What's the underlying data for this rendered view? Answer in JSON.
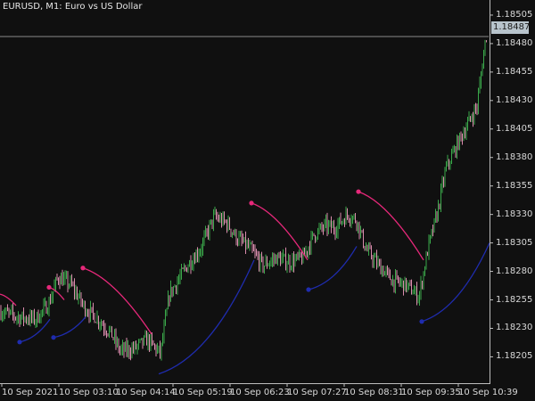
{
  "window": {
    "title": "EURUSD, M1:  Euro vs US Dollar",
    "current_price": "1.18487"
  },
  "colors": {
    "background": "#101010",
    "bull_candle": "#3aa84a",
    "bear_candle": "#d98cac",
    "upper_arc": "#e6287a",
    "lower_arc": "#1f2cae",
    "grid_line": "#8a8a8a"
  },
  "chart_data": {
    "type": "candlestick",
    "symbol": "EURUSD",
    "timeframe": "M1",
    "y_tick_labels": [
      "1.18505",
      "1.18480",
      "1.18455",
      "1.18430",
      "1.18405",
      "1.18380",
      "1.18355",
      "1.18330",
      "1.18305",
      "1.18280",
      "1.18255",
      "1.18230",
      "1.18205"
    ],
    "x_tick_labels": [
      "10 Sep 2021",
      "10 Sep 03:10",
      "10 Sep 04:14",
      "10 Sep 05:19",
      "10 Sep 06:23",
      "10 Sep 07:27",
      "10 Sep 08:31",
      "10 Sep 09:35",
      "10 Sep 10:39"
    ],
    "ylim": [
      1.18185,
      1.18512
    ],
    "price_trace": [
      [
        0,
        1.18245
      ],
      [
        20,
        1.1824
      ],
      [
        40,
        1.18238
      ],
      [
        55,
        1.18252
      ],
      [
        65,
        1.18275
      ],
      [
        80,
        1.18268
      ],
      [
        95,
        1.18248
      ],
      [
        110,
        1.18238
      ],
      [
        125,
        1.18225
      ],
      [
        135,
        1.1821
      ],
      [
        150,
        1.18212
      ],
      [
        165,
        1.1822
      ],
      [
        180,
        1.18208
      ],
      [
        190,
        1.1826
      ],
      [
        210,
        1.18285
      ],
      [
        225,
        1.183
      ],
      [
        240,
        1.18328
      ],
      [
        255,
        1.18322
      ],
      [
        265,
        1.1831
      ],
      [
        280,
        1.183
      ],
      [
        295,
        1.18285
      ],
      [
        310,
        1.18292
      ],
      [
        325,
        1.18288
      ],
      [
        340,
        1.18292
      ],
      [
        352,
        1.18312
      ],
      [
        365,
        1.1832
      ],
      [
        375,
        1.18318
      ],
      [
        390,
        1.1833
      ],
      [
        400,
        1.18325
      ],
      [
        410,
        1.183
      ],
      [
        425,
        1.18285
      ],
      [
        440,
        1.18272
      ],
      [
        455,
        1.18268
      ],
      [
        470,
        1.18258
      ],
      [
        480,
        1.183
      ],
      [
        490,
        1.1833
      ],
      [
        500,
        1.1837
      ],
      [
        515,
        1.18395
      ],
      [
        525,
        1.1841
      ],
      [
        535,
        1.18425
      ],
      [
        545,
        1.18487
      ]
    ],
    "upper_arcs": [
      {
        "from": [
          0,
          1.1826
        ],
        "to": [
          18,
          1.1825
        ]
      },
      {
        "from": [
          55,
          1.18266
        ],
        "to": [
          72,
          1.18255
        ]
      },
      {
        "from": [
          93,
          1.18283
        ],
        "to": [
          170,
          1.18225
        ]
      },
      {
        "from": [
          282,
          1.1834
        ],
        "to": [
          345,
          1.1829
        ]
      },
      {
        "from": [
          402,
          1.1835
        ],
        "to": [
          475,
          1.1829
        ]
      }
    ],
    "lower_arcs": [
      {
        "from": [
          22,
          1.18218
        ],
        "to": [
          56,
          1.18238
        ]
      },
      {
        "from": [
          60,
          1.18222
        ],
        "to": [
          96,
          1.1824
        ]
      },
      {
        "from": [
          178,
          1.1819
        ],
        "to": [
          285,
          1.1829
        ]
      },
      {
        "from": [
          346,
          1.18264
        ],
        "to": [
          400,
          1.18302
        ]
      },
      {
        "from": [
          473,
          1.18236
        ],
        "to": [
          549,
          1.18305
        ]
      }
    ],
    "upper_markers": [
      [
        55,
        1.18266
      ],
      [
        93,
        1.18283
      ],
      [
        282,
        1.1834
      ],
      [
        402,
        1.1835
      ]
    ],
    "lower_markers": [
      [
        22,
        1.18218
      ],
      [
        60,
        1.18222
      ],
      [
        346,
        1.18264
      ],
      [
        473,
        1.18236
      ]
    ]
  }
}
